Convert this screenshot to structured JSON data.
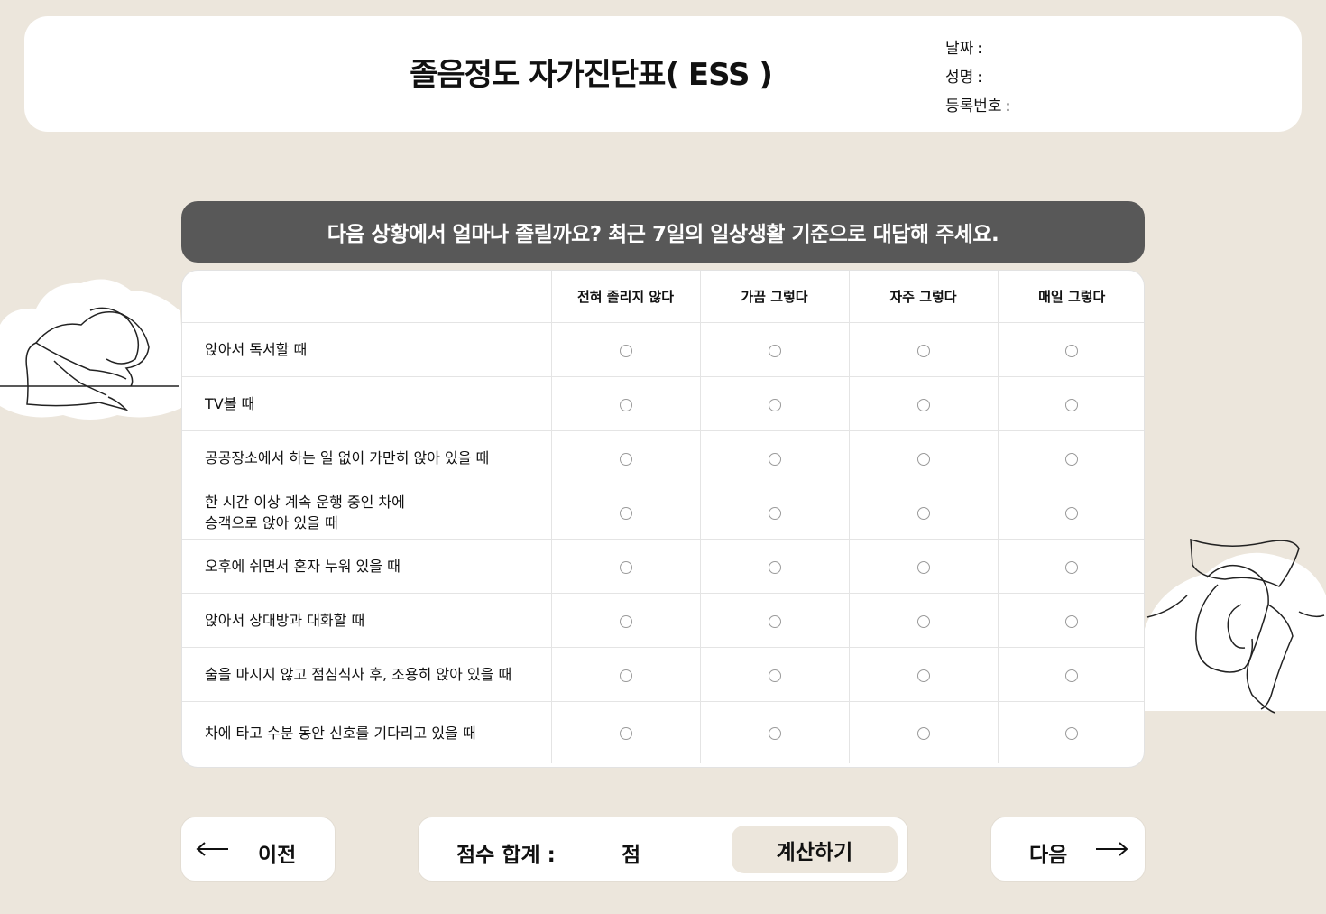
{
  "header": {
    "title": "졸음정도 자가진단표( ESS )",
    "date_label": "날짜",
    "name_label": "성명",
    "reg_label": "등록번호",
    "colon": ":"
  },
  "banner": {
    "text": "다음 상황에서 얼마나 졸릴까요? 최근 7일의 일상생활 기준으로 대답해 주세요."
  },
  "table": {
    "columns": [
      "전혀 졸리지 않다",
      "가끔 그렇다",
      "자주 그렇다",
      "매일 그렇다"
    ],
    "rows": [
      "앉아서 독서할 때",
      "TV볼 때",
      "공공장소에서 하는 일 없이 가만히 앉아 있을 때",
      "한 시간 이상 계속 운행 중인 차에\n승객으로 앉아 있을 때",
      "오후에 쉬면서 혼자 누워 있을 때",
      "앉아서 상대방과 대화할 때",
      "술을 마시지 않고 점심식사 후, 조용히 앉아 있을 때",
      "차에 타고 수분 동안 신호를 기다리고 있을 때"
    ]
  },
  "footer": {
    "prev_label": "이전",
    "score_label": "점수 합계 :",
    "score_unit": "점",
    "calc_label": "계산하기",
    "next_label": "다음"
  },
  "icons": {
    "prev": "left-arrow-icon",
    "next": "right-arrow-icon",
    "illustration_left": "sleeping-person-illustration",
    "illustration_right": "lying-person-illustration"
  },
  "colors": {
    "background": "#ece6dc",
    "banner": "#585858",
    "card": "#ffffff"
  }
}
